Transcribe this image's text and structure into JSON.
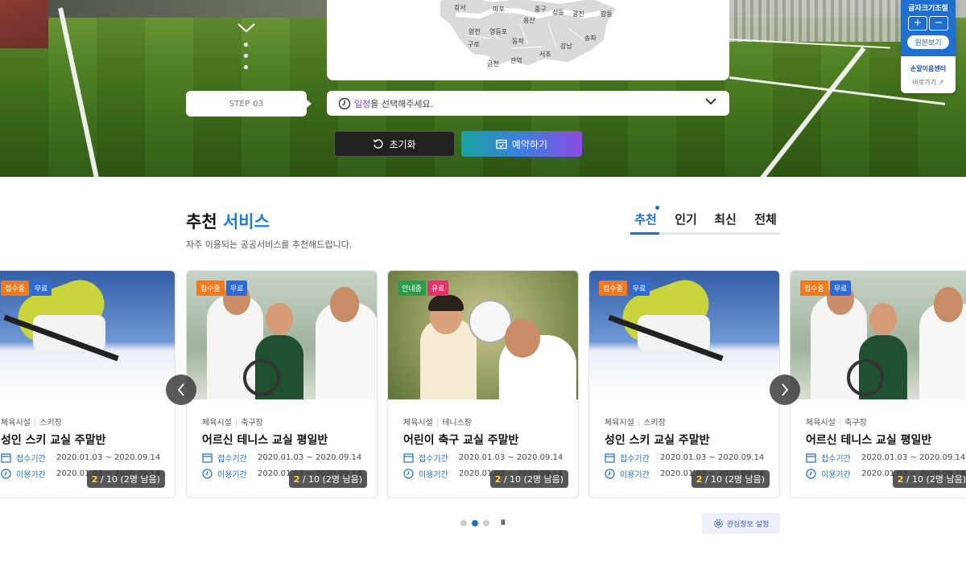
{
  "hero": {
    "step_label": "STEP 03",
    "schedule_accent": "일정",
    "schedule_rest": "을 선택해주세요.",
    "reset_label": "초기화",
    "reserve_label": "예약하기",
    "map_districts": [
      "강서",
      "마포",
      "중구",
      "성동",
      "광진",
      "강동",
      "용산",
      "양천",
      "영등포",
      "구로",
      "동작",
      "강남",
      "송파",
      "서초",
      "관악",
      "금천"
    ]
  },
  "font_size_widget": {
    "title": "글자크기조절",
    "plus": "+",
    "minus": "−",
    "original": "원본보기",
    "sign_center": "손말이음센터",
    "go": "바로가기"
  },
  "section": {
    "title_main": "추천",
    "title_accent": "서비스",
    "subtitle": "자주 이용되는 공공서비스를 추천해드립니다.",
    "tabs": [
      "추천",
      "인기",
      "최신",
      "전체"
    ]
  },
  "cards": [
    {
      "badges": [
        "접수중",
        "무료"
      ],
      "count_num": "2",
      "count_rest": "/ 10 (2명 남음)",
      "category": "체육시설",
      "sub": "스키장",
      "name": "성인 스키 교실 주말반",
      "receipt_label": "접수기간",
      "receipt": "2020.01.03 ~ 2020.09.14",
      "use_label": "이용기간",
      "use": "2020.01.03 ~ 2020.09.14"
    },
    {
      "badges": [
        "접수중",
        "무료"
      ],
      "count_num": "2",
      "count_rest": "/ 10 (2명 남음)",
      "category": "체육시설",
      "sub": "축구장",
      "name": "어르신 테니스 교실 평일반",
      "receipt_label": "접수기간",
      "receipt": "2020.01.03 ~ 2020.09.14",
      "use_label": "이용기간",
      "use": "2020.01.03 ~ 2020.09.14"
    },
    {
      "badges": [
        "안내중",
        "유료"
      ],
      "count_num": "2",
      "count_rest": "/ 10 (2명 남음)",
      "category": "체육시설",
      "sub": "테니스장",
      "name": "어린이 축구 교실 주말반",
      "receipt_label": "접수기간",
      "receipt": "2020.01.03 ~ 2020.09.14",
      "use_label": "이용기간",
      "use": "2020.01.03 ~ 2020.09.14"
    },
    {
      "badges": [
        "접수중",
        "무료"
      ],
      "count_num": "2",
      "count_rest": "/ 10 (2명 남음)",
      "category": "체육시설",
      "sub": "스키장",
      "name": "성인 스키 교실 주말반",
      "receipt_label": "접수기간",
      "receipt": "2020.01.03 ~ 2020.09.14",
      "use_label": "이용기간",
      "use": "2020.01.03 ~ 2020.09.14"
    },
    {
      "badges": [
        "접수중",
        "무료"
      ],
      "count_num": "2",
      "count_rest": "/ 10 (2명 남음)",
      "category": "체육시설",
      "sub": "축구장",
      "name": "어르신 테니스 교실 평일반",
      "receipt_label": "접수기간",
      "receipt": "2020.01.03 ~ 2020.09.14",
      "use_label": "이용기간",
      "use": "2020.01.03 ~ 2020.09.14"
    }
  ],
  "pager": {
    "pause": "II",
    "active_index": 1
  },
  "interest_label": "관심정보 설정",
  "colors": {
    "accent": "#1f6fd0",
    "purple": "#7e3bd8",
    "orange_badge": "#f07a1d",
    "blue_badge": "#2f6bd3",
    "green_badge": "#2e9c4a",
    "pink_badge": "#e2326f"
  }
}
